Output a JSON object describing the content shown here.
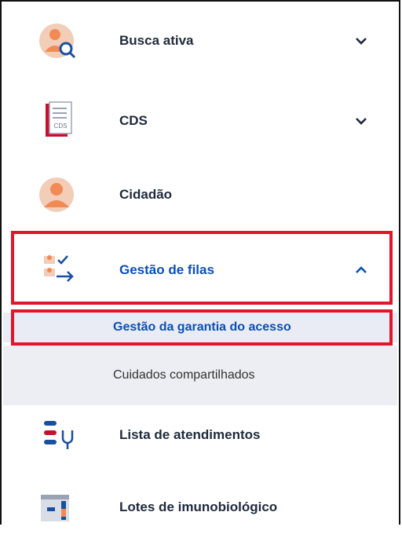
{
  "menu": {
    "items": [
      {
        "label": "Busca ativa",
        "icon": "busca-ativa-icon"
      },
      {
        "label": "CDS",
        "icon": "cds-document-icon",
        "icon_text": "CDS"
      },
      {
        "label": "Cidadão",
        "icon": "cidadao-icon"
      },
      {
        "label": "Gestão de filas",
        "icon": "gestao-filas-icon",
        "expanded": true
      },
      {
        "label": "Lista de atendimentos",
        "icon": "lista-atendimentos-icon"
      },
      {
        "label": "Lotes de imunobiológico",
        "icon": "lotes-imunobiologico-icon"
      }
    ],
    "gestao_submenu": [
      {
        "label": "Gestão da garantia do acesso",
        "active": true
      },
      {
        "label": "Cuidados compartilhados",
        "active": false
      }
    ]
  },
  "colors": {
    "accent": "#0b4fb5",
    "highlight": "#e0162b",
    "submenu_bg": "#e9ecf4",
    "text": "#1f2a3c"
  }
}
